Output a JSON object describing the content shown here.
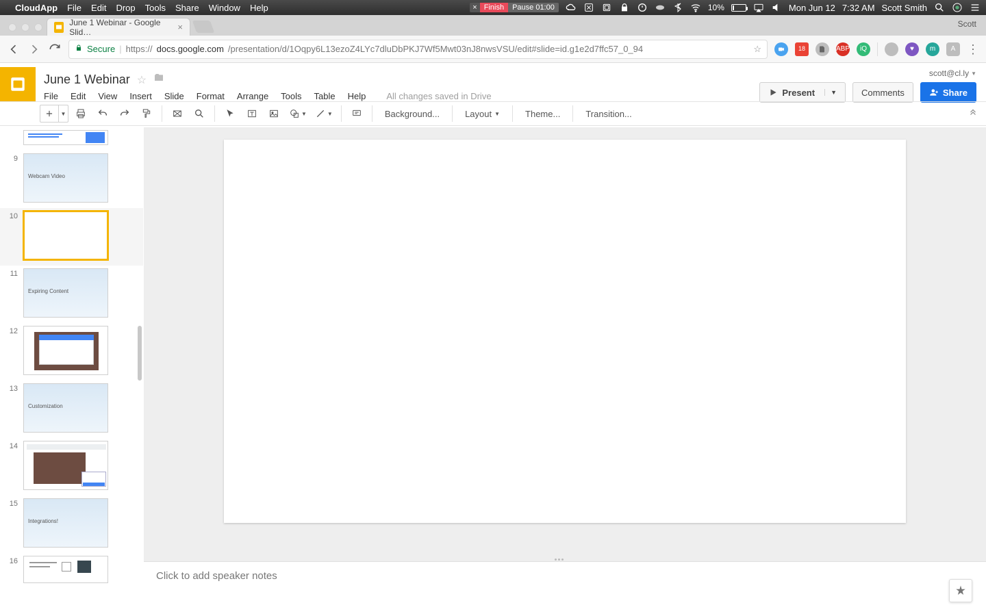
{
  "menubar": {
    "app_name": "CloudApp",
    "items": [
      "File",
      "Edit",
      "Drop",
      "Tools",
      "Share",
      "Window",
      "Help"
    ],
    "rec_close": "×",
    "rec_finish": "Finish",
    "rec_pause": "Pause 01:00",
    "battery_pct": "10%",
    "date": "Mon Jun 12",
    "time": "7:32 AM",
    "user": "Scott Smith"
  },
  "browser": {
    "tab_title": "June 1 Webinar - Google Slid…",
    "tab_close": "×",
    "profile": "Scott",
    "secure_label": "Secure",
    "url_host": "docs.google.com",
    "url_path": "/presentation/d/1Oqpy6L13ezoZ4LYc7dluDbPKJ7Wf5Mwt03nJ8nwsVSU/edit#slide=id.g1e2d7ffc57_0_94",
    "ext_cal_day": "18"
  },
  "slides": {
    "doc_title": "June 1 Webinar",
    "menus": [
      "File",
      "Edit",
      "View",
      "Insert",
      "Slide",
      "Format",
      "Arrange",
      "Tools",
      "Table",
      "Help"
    ],
    "saved": "All changes saved in Drive",
    "user_email": "scott@cl.ly",
    "present": "Present",
    "comments": "Comments",
    "share": "Share",
    "toolbar": {
      "background": "Background...",
      "layout": "Layout",
      "theme": "Theme...",
      "transition": "Transition..."
    },
    "notes_placeholder": "Click to add speaker notes",
    "thumbs": [
      {
        "num": "",
        "kind": "partial"
      },
      {
        "num": "9",
        "kind": "sky",
        "label": "Webcam Video"
      },
      {
        "num": "10",
        "kind": "blank",
        "selected": true
      },
      {
        "num": "11",
        "kind": "sky",
        "label": "Expiring Content"
      },
      {
        "num": "12",
        "kind": "screenshot1"
      },
      {
        "num": "13",
        "kind": "sky",
        "label": "Customization"
      },
      {
        "num": "14",
        "kind": "screenshot2"
      },
      {
        "num": "15",
        "kind": "sky",
        "label": "Integrations!"
      },
      {
        "num": "16",
        "kind": "diagram"
      }
    ]
  }
}
